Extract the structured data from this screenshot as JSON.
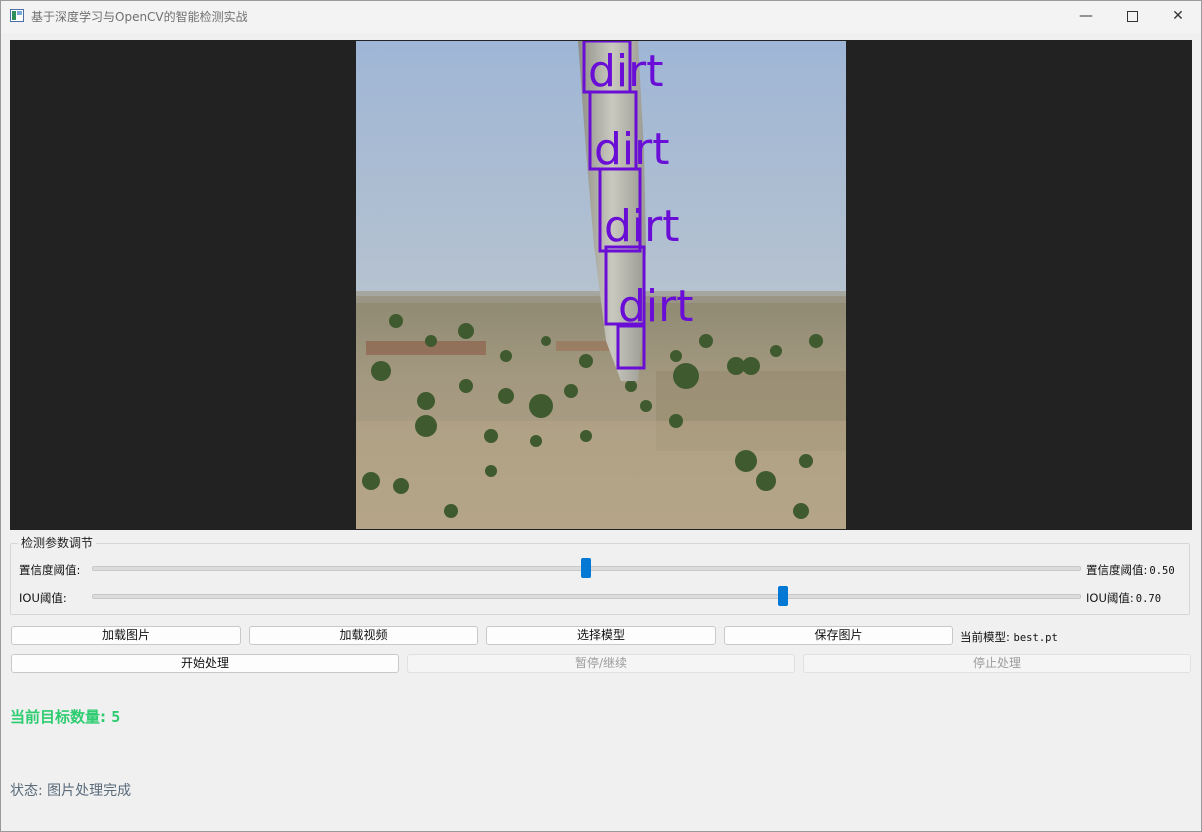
{
  "window": {
    "title": "基于深度学习与OpenCV的智能检测实战",
    "controls": {
      "minimize": "—",
      "close": "✕"
    }
  },
  "image": {
    "detections": [
      {
        "label": "dirt"
      },
      {
        "label": "dirt"
      },
      {
        "label": "dirt"
      },
      {
        "label": "dirt"
      },
      {
        "label": ""
      }
    ],
    "box_color": "#6a0dd6"
  },
  "params": {
    "group_title": "检测参数调节",
    "confidence": {
      "label": "置信度阈值:",
      "value_label": "置信度阈值:",
      "value": "0.50",
      "fraction": 0.5
    },
    "iou": {
      "label": "IOU阈值:",
      "value_label": "IOU阈值:",
      "value": "0.70",
      "fraction": 0.7
    }
  },
  "buttons": {
    "load_image": "加载图片",
    "load_video": "加载视频",
    "select_model": "选择模型",
    "save_image": "保存图片",
    "start": "开始处理",
    "pause": "暂停/继续",
    "stop": "停止处理"
  },
  "model": {
    "label": "当前模型:",
    "name": "best.pt"
  },
  "count": {
    "label": "当前目标数量:",
    "value": "5"
  },
  "status": {
    "text": "状态: 图片处理完成"
  },
  "colors": {
    "accent": "#0078d4",
    "count_text": "#2ecc71",
    "status_text": "#5a6b7b",
    "display_bg": "#222222"
  }
}
